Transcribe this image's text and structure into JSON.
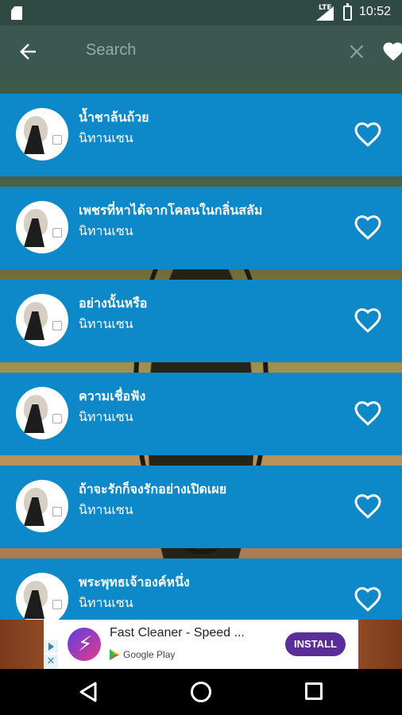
{
  "status_bar": {
    "time": "10:52",
    "network_label": "LTE",
    "icons": [
      "sd-card-icon",
      "signal-icon",
      "battery-charging-icon"
    ]
  },
  "toolbar": {
    "search_placeholder": "Search",
    "icons": [
      "back-arrow-icon",
      "clear-icon",
      "favorites-heart-icon"
    ]
  },
  "stories": [
    {
      "title": "น้ำชาล้นถ้วย",
      "author": "นิทานเซน"
    },
    {
      "title": "เพชรที่หาได้จากโคลนในกลิ่นสลัม",
      "author": "นิทานเซน"
    },
    {
      "title": "อย่างนั้นหรือ",
      "author": "นิทานเซน"
    },
    {
      "title": "ความเชื่อฟัง",
      "author": "นิทานเซน"
    },
    {
      "title": "ถ้าจะรักก็จงรักอย่างเปิดเผย",
      "author": "นิทานเซน"
    },
    {
      "title": "พระพุทธเจ้าองค์หนึ่ง",
      "author": "นิทานเซน"
    }
  ],
  "ad": {
    "app_name": "Fast Cleaner - Speed ...",
    "store_label": "Google Play",
    "install_label": "INSTALL",
    "close_glyph": "✕"
  },
  "colors": {
    "card": "#0d89c9",
    "toolbar": "#3b5750",
    "status_bar": "#2f4a43",
    "install_button": "#5b2d9a"
  }
}
